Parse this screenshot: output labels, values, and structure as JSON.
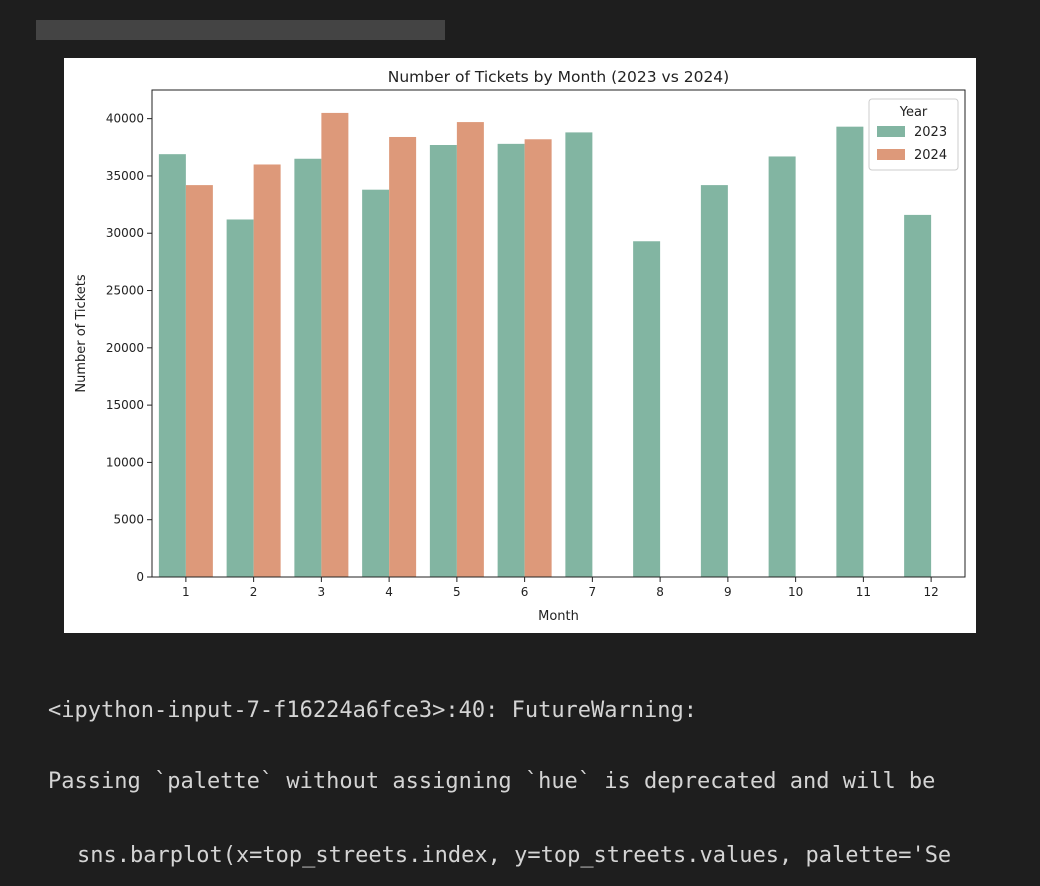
{
  "colors": {
    "background": "#1e1e1e",
    "bar_2023": "#82b5a2",
    "bar_2024": "#dd997a",
    "text": "#d4d4d4"
  },
  "chart_data": {
    "type": "bar",
    "title": "Number of Tickets by Month (2023 vs 2024)",
    "xlabel": "Month",
    "ylabel": "Number of Tickets",
    "categories": [
      "1",
      "2",
      "3",
      "4",
      "5",
      "6",
      "7",
      "8",
      "9",
      "10",
      "11",
      "12"
    ],
    "ylim": [
      0,
      42500
    ],
    "yticks": [
      0,
      5000,
      10000,
      15000,
      20000,
      25000,
      30000,
      35000,
      40000
    ],
    "legend": {
      "title": "Year",
      "position": "top-right"
    },
    "grid": false,
    "series": [
      {
        "name": "2023",
        "values": [
          36900,
          31200,
          36500,
          33800,
          37700,
          37800,
          38800,
          29300,
          34200,
          36700,
          39300,
          31600
        ]
      },
      {
        "name": "2024",
        "values": [
          34200,
          36000,
          40500,
          38400,
          39700,
          38200,
          null,
          null,
          null,
          null,
          null,
          null
        ]
      }
    ]
  },
  "output": {
    "line1": "<ipython-input-7-f16224a6fce3>:40: FutureWarning:",
    "line2": "Passing `palette` without assigning `hue` is deprecated and will be",
    "line3": "sns.barplot(x=top_streets.index, y=top_streets.values, palette='Se"
  }
}
